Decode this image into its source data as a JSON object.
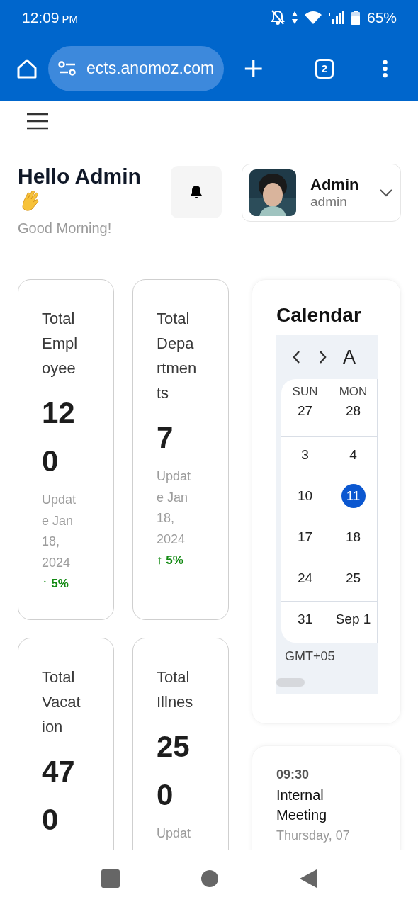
{
  "status_bar": {
    "time": "12:09",
    "ampm": "PM",
    "battery": "65%"
  },
  "browser": {
    "url": "ects.anomoz.com",
    "tab_count": "2"
  },
  "greeting": {
    "title": "Hello Admin",
    "subtitle": "Good Morning!"
  },
  "profile": {
    "name": "Admin",
    "role": "admin"
  },
  "stats": [
    {
      "title": "Total Employee",
      "value": "120",
      "updated": "Update Jan 18, 2024",
      "trend": "↑ 5%"
    },
    {
      "title": "Total Departments",
      "value": "7",
      "updated": "Update Jan 18, 2024",
      "trend": "↑ 5%"
    },
    {
      "title": "Total Vacation",
      "value": "470"
    },
    {
      "title": "Total Illnes",
      "value": "250",
      "updated": "Updat"
    }
  ],
  "calendar": {
    "title": "Calendar",
    "month": "A",
    "weekdays": [
      "SUN",
      "MON"
    ],
    "weeks": [
      [
        {
          "label": "27",
          "selected": false
        },
        {
          "label": "28",
          "selected": false
        }
      ],
      [
        {
          "label": "3",
          "selected": false
        },
        {
          "label": "4",
          "selected": false
        }
      ],
      [
        {
          "label": "10",
          "selected": false
        },
        {
          "label": "11",
          "selected": true
        }
      ],
      [
        {
          "label": "17",
          "selected": false
        },
        {
          "label": "18",
          "selected": false
        }
      ],
      [
        {
          "label": "24",
          "selected": false
        },
        {
          "label": "25",
          "selected": false
        }
      ],
      [
        {
          "label": "31",
          "selected": false
        },
        {
          "label": "Sep 1",
          "selected": false
        }
      ]
    ],
    "timezone": "GMT+05"
  },
  "event": {
    "time": "09:30",
    "title": "Internal Meeting",
    "date": "Thursday, 07"
  }
}
